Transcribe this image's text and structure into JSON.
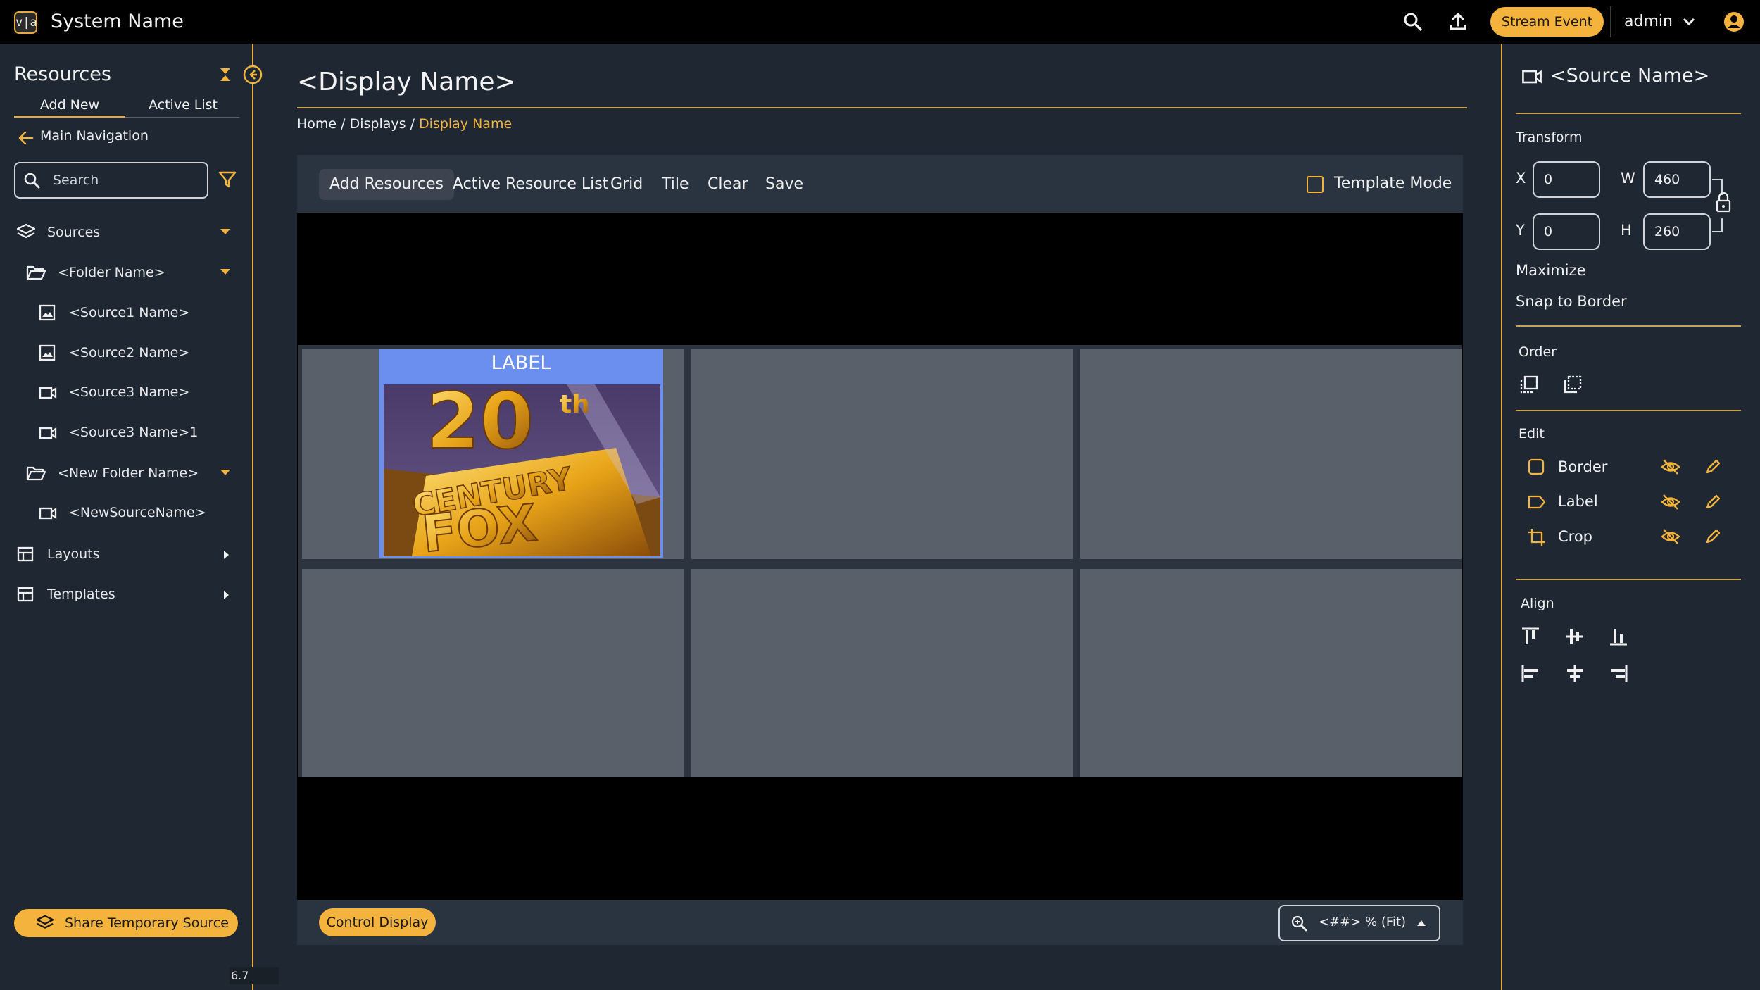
{
  "app": {
    "logo_text": "v|a",
    "system_name": "System Name",
    "stream_event_label": "Stream Event",
    "user_name": "admin"
  },
  "sidebar": {
    "title": "Resources",
    "tabs": [
      "Add New",
      "Active List"
    ],
    "main_nav_label": "Main Navigation",
    "search_placeholder": "Search",
    "tree": [
      {
        "label": "Sources",
        "icon": "layers-icon",
        "expander": "caret-down"
      },
      {
        "label": "<Folder Name>",
        "icon": "folder-open-icon",
        "expander": "caret-down"
      },
      {
        "label": "<Source1 Name>",
        "icon": "image-icon"
      },
      {
        "label": "<Source2 Name>",
        "icon": "image-icon"
      },
      {
        "label": "<Source3 Name>",
        "icon": "video-camera-icon"
      },
      {
        "label": "<Source3 Name>1",
        "icon": "video-camera-icon"
      },
      {
        "label": "<New Folder Name>",
        "icon": "folder-open-icon",
        "expander": "caret-down"
      },
      {
        "label": "<NewSourceName>",
        "icon": "video-camera-icon"
      },
      {
        "label": "Layouts",
        "icon": "layout-icon",
        "expander": "caret-right"
      },
      {
        "label": "Templates",
        "icon": "layout-icon",
        "expander": "caret-right"
      }
    ],
    "share_button_label": "Share Temporary Source",
    "version": "6.7"
  },
  "main": {
    "display_title": "<Display Name>",
    "breadcrumb": {
      "home": "Home",
      "sep1": " / ",
      "displays": "Displays",
      "sep2": " / ",
      "current": "Display Name"
    },
    "toolbar": {
      "add_resources": "Add Resources",
      "active_resource_list": "Active Resource List",
      "grid": "Grid",
      "tile": "Tile",
      "clear": "Clear",
      "save": "Save",
      "template_mode_label": "Template Mode",
      "template_mode_checked": false
    },
    "tile": {
      "label": "LABEL",
      "image_text_line1": "20",
      "image_text_sup": "th",
      "image_text_line2": "CENTURY",
      "image_text_line3": "FOX"
    },
    "control_display_label": "Control Display",
    "zoom_label": "<##> % (Fit)"
  },
  "right_panel": {
    "source_name": "<Source Name>",
    "transform_title": "Transform",
    "x_label": "X",
    "x_value": "0",
    "y_label": "Y",
    "y_value": "0",
    "w_label": "W",
    "w_value": "460",
    "h_label": "H",
    "h_value": "260",
    "maximize_label": "Maximize",
    "snap_label": "Snap to Border",
    "order_title": "Order",
    "edit_title": "Edit",
    "edit_items": [
      {
        "label": "Border",
        "icon": "square-icon"
      },
      {
        "label": "Label",
        "icon": "tag-icon"
      },
      {
        "label": "Crop",
        "icon": "crop-icon"
      }
    ],
    "align_title": "Align"
  },
  "colors": {
    "accent": "#f3b33d",
    "background": "#1f2733",
    "panel": "#2a3340",
    "cell": "#5a6069",
    "tile_highlight": "#6b8fef"
  }
}
